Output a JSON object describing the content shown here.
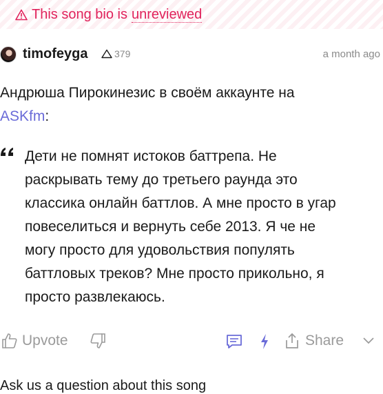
{
  "banner": {
    "prefix": "This song bio is",
    "link": "unreviewed",
    "icon": "warning-triangle-icon",
    "color": "#e0225b"
  },
  "post": {
    "username": "timofeyga",
    "iq": "379",
    "time": "a month ago",
    "intro_text": "Андрюша Пирокинезис в своём аккаунте на",
    "intro_link": "ASKfm",
    "intro_suffix": ":",
    "quote_lines": [
      "Дети не помнят истоков баттрепа. Не",
      "раскрывать тему до третьего раунда это",
      "классика онлайн баттлов. А мне просто в угар",
      "повеселиться и вернуть себе 2013. Я че не",
      "могу просто для удовольствия популять",
      "баттловых треков? Мне просто прикольно, я",
      "просто развлекаюсь."
    ]
  },
  "actions": {
    "upvote_label": "Upvote",
    "share_label": "Share",
    "accent": "#6a6bd8",
    "muted": "#9a9a9a"
  },
  "footer": {
    "ask": "Ask us a question about this song"
  }
}
